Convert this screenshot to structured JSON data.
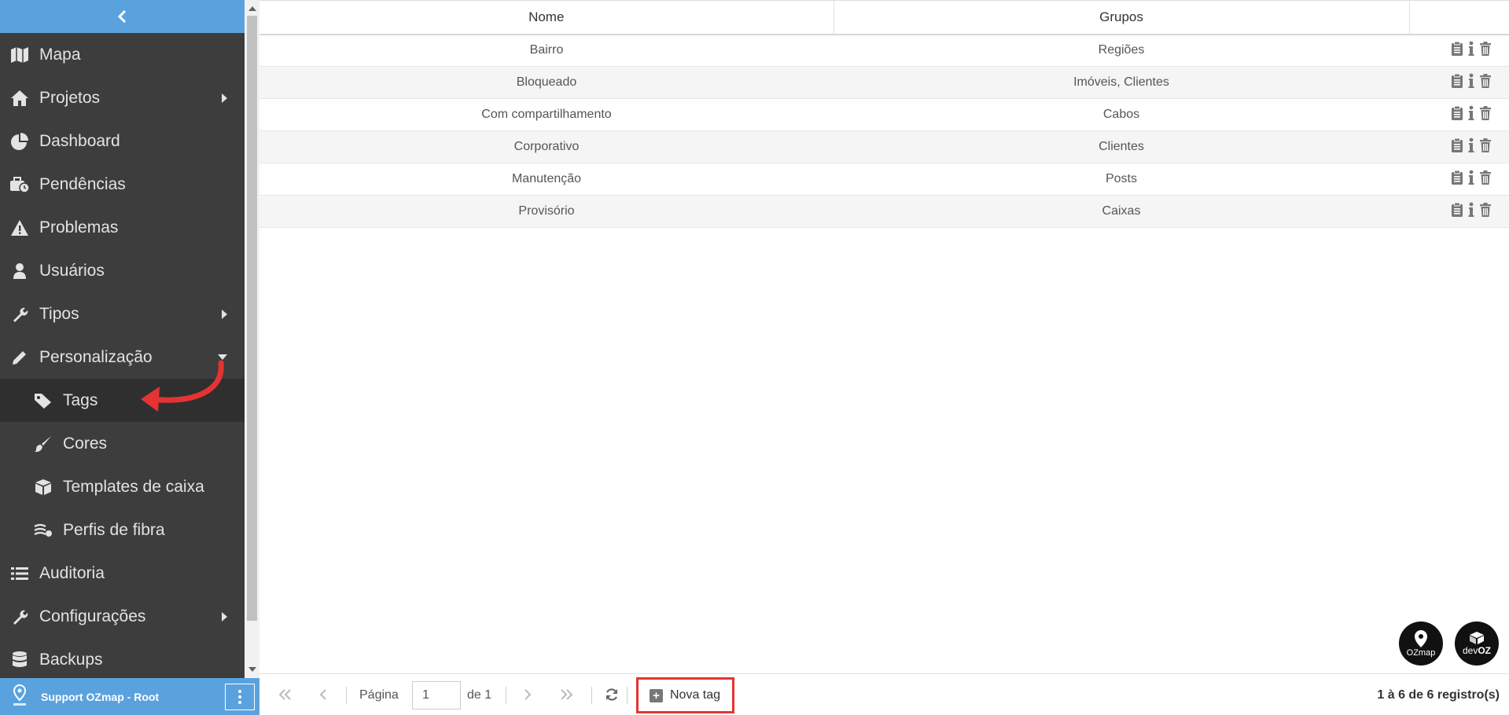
{
  "sidebar": {
    "items": [
      {
        "label": "Mapa",
        "icon": "map-icon"
      },
      {
        "label": "Projetos",
        "icon": "home-icon"
      },
      {
        "label": "Dashboard",
        "icon": "pie-chart-icon"
      },
      {
        "label": "Pendências",
        "icon": "briefcase-clock-icon"
      },
      {
        "label": "Problemas",
        "icon": "warning-icon"
      },
      {
        "label": "Usuários",
        "icon": "user-icon"
      },
      {
        "label": "Tipos",
        "icon": "wrench-icon"
      },
      {
        "label": "Personalização",
        "icon": "pencil-icon"
      },
      {
        "label": "Tags",
        "icon": "tag-icon"
      },
      {
        "label": "Cores",
        "icon": "paint-brush-icon"
      },
      {
        "label": "Templates de caixa",
        "icon": "cube-icon"
      },
      {
        "label": "Perfis de fibra",
        "icon": "fiber-icon"
      },
      {
        "label": "Auditoria",
        "icon": "list-icon"
      },
      {
        "label": "Configurações",
        "icon": "wrench-icon"
      },
      {
        "label": "Backups",
        "icon": "database-icon"
      }
    ],
    "active_item": "Tags",
    "user": {
      "name": "Support OZmap - Root",
      "logo_text": "OZmap"
    }
  },
  "table": {
    "columns": [
      "Nome",
      "Grupos",
      ""
    ],
    "rows": [
      {
        "nome": "Bairro",
        "grupos": "Regiões"
      },
      {
        "nome": "Bloqueado",
        "grupos": "Imóveis, Clientes"
      },
      {
        "nome": "Com compartilhamento",
        "grupos": "Cabos"
      },
      {
        "nome": "Corporativo",
        "grupos": "Clientes"
      },
      {
        "nome": "Manutenção",
        "grupos": "Posts"
      },
      {
        "nome": "Provisório",
        "grupos": "Caixas"
      }
    ]
  },
  "brands": {
    "ozmap": "OZmap",
    "devoz_prefix": "dev",
    "devoz_suffix": "OZ"
  },
  "footer": {
    "page_label": "Página",
    "page_value": "1",
    "page_total": "de 1",
    "new_tag_label": "Nova tag",
    "records": "1 à 6 de 6 registro(s)"
  },
  "colors": {
    "sidebar_bg": "#3d3d3d",
    "accent_blue": "#5aa2de",
    "highlight_red": "#e53333"
  }
}
